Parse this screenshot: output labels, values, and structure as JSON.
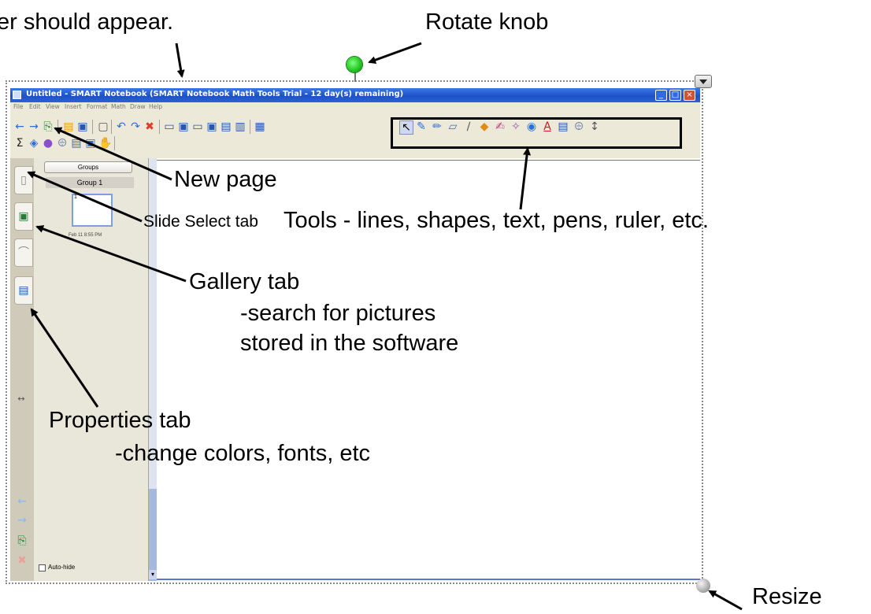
{
  "window": {
    "title": "Untitled - SMART Notebook (SMART Notebook Math Tools Trial - 12 day(s) remaining)",
    "minimize_label": "_",
    "maximize_label": "□",
    "close_label": "×"
  },
  "menu": {
    "items": [
      "File",
      "Edit",
      "View",
      "Insert",
      "Format",
      "Math",
      "Draw",
      "Help"
    ]
  },
  "side_panel": {
    "groups_button": "Groups",
    "group_header": "Group 1",
    "thumb_number": "1",
    "thumb_caption": "Feb 11 8:55 PM",
    "autohide_label": "Auto-hide"
  },
  "callouts": {
    "top_cut": "er should appear.",
    "rotate_knob": "Rotate knob",
    "new_page": "New page",
    "slide_select_tab": "Slide Select tab",
    "tools": "Tools - lines, shapes, text, pens, ruler, etc.",
    "gallery_tab": "Gallery tab",
    "gallery_desc_1": "-search for pictures",
    "gallery_desc_2": "stored in the software",
    "properties_tab": "Properties tab",
    "properties_desc": "-change colors, fonts, etc",
    "resize": "Resize"
  },
  "icons": {
    "back": "arrow-left-icon",
    "forward": "arrow-right-icon",
    "new_page": "add-page-icon",
    "open": "folder-icon",
    "save": "save-icon",
    "undo": "undo-icon",
    "redo": "redo-icon",
    "delete": "delete-icon",
    "select": "select-pointer-icon",
    "text": "text-icon",
    "sigma": "sigma-icon"
  },
  "colors": {
    "titlebar": "#1d52c7",
    "window_bg": "#ece9d8",
    "rotate_knob": "#1fc21f",
    "delete_red": "#e03a2a",
    "arrow_blue": "#2d6fd8"
  }
}
